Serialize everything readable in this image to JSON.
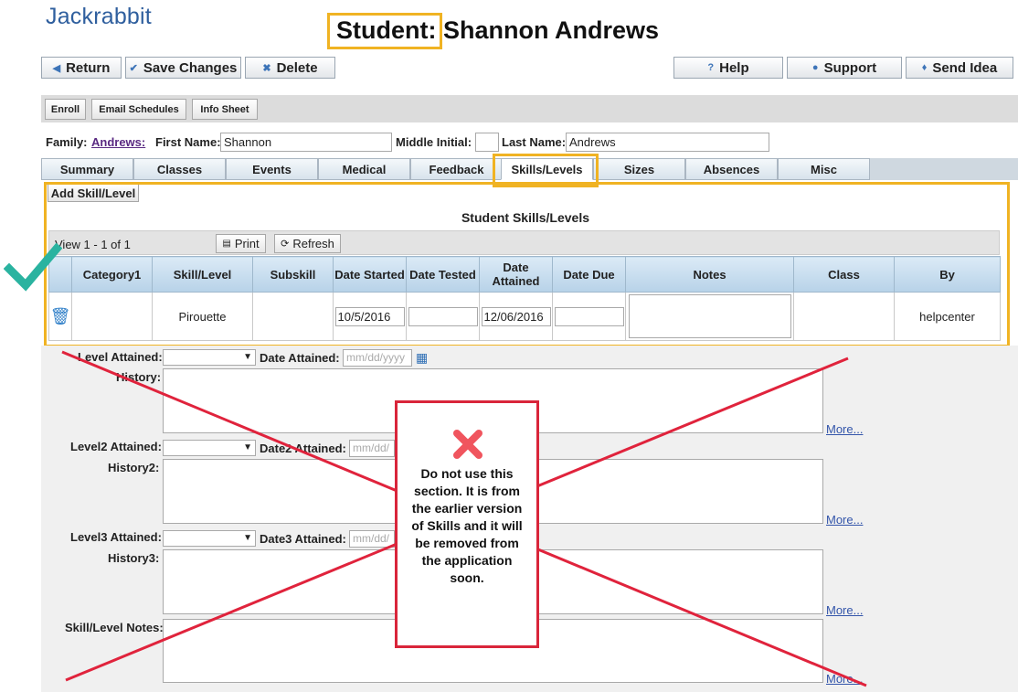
{
  "app": {
    "logo": "Jackrabbit"
  },
  "page": {
    "title_label": "Student:",
    "student_name": "Shannon Andrews"
  },
  "toolbar": {
    "return_label": "Return",
    "save_label": "Save Changes",
    "delete_label": "Delete",
    "help_label": "Help",
    "support_label": "Support",
    "send_idea_label": "Send Idea"
  },
  "subtoolbar": {
    "enroll": "Enroll",
    "email_schedules": "Email Schedules",
    "info_sheet": "Info Sheet"
  },
  "header_fields": {
    "family_label": "Family:",
    "family_value": "Andrews:",
    "first_name_label": "First Name:",
    "first_name_value": "Shannon",
    "middle_initial_label": "Middle Initial:",
    "middle_initial_value": "",
    "last_name_label": "Last Name:",
    "last_name_value": "Andrews"
  },
  "tabs": [
    {
      "label": "Summary"
    },
    {
      "label": "Classes"
    },
    {
      "label": "Events"
    },
    {
      "label": "Medical"
    },
    {
      "label": "Feedback"
    },
    {
      "label": "Skills/Levels",
      "active": true
    },
    {
      "label": "Sizes"
    },
    {
      "label": "Absences"
    },
    {
      "label": "Misc"
    }
  ],
  "skills": {
    "add_button": "Add Skill/Level",
    "panel_title": "Student Skills/Levels",
    "view_count": "View 1 - 1 of 1",
    "print_label": "Print",
    "refresh_label": "Refresh",
    "columns": [
      "",
      "Category1",
      "Skill/Level",
      "Subskill",
      "Date Started",
      "Date Tested",
      "Date Attained",
      "Date Due",
      "Notes",
      "Class",
      "By"
    ],
    "rows": [
      {
        "category": "",
        "skill": "Pirouette",
        "subskill": "",
        "date_started": "10/5/2016",
        "date_tested": "",
        "date_attained": "12/06/2016",
        "date_due": "",
        "notes": "",
        "class": "",
        "by": "helpcenter"
      }
    ]
  },
  "legacy": {
    "level_attained_label": "Level Attained:",
    "date_attained_label": "Date Attained:",
    "date_placeholder": "mm/dd/yyyy",
    "history_label": "History:",
    "level2_label": "Level2 Attained:",
    "date2_label": "Date2 Attained:",
    "date2_placeholder": "mm/dd/",
    "history2_label": "History2:",
    "level3_label": "Level3 Attained:",
    "date3_label": "Date3 Attained:",
    "date3_placeholder": "mm/dd/",
    "history3_label": "History3:",
    "notes_label": "Skill/Level Notes:",
    "more_label": "More..."
  },
  "annotation": {
    "warning_text": "Do not use this section. It is from the earlier version of Skills and it will be removed from the application soon.",
    "highlight_color": "#f0b323",
    "warning_color": "#d9253a",
    "check_color": "#2ab3a0"
  }
}
